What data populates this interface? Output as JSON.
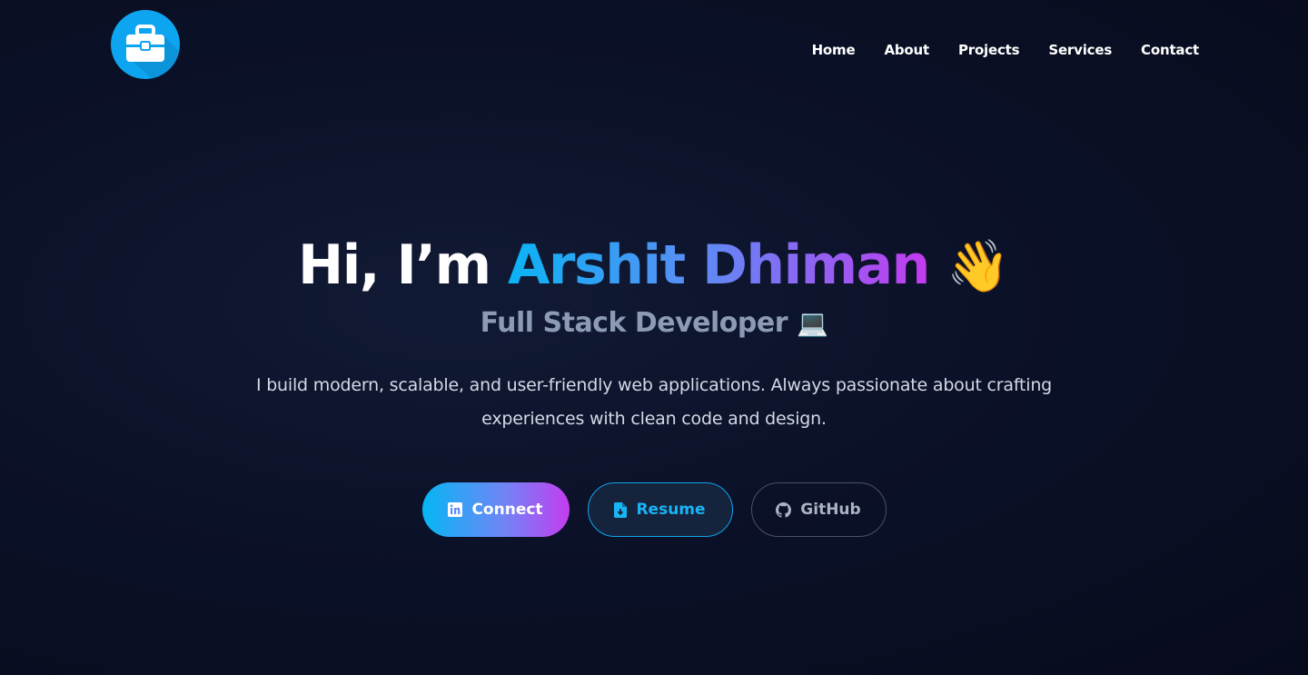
{
  "header": {
    "logo": {
      "icon": "briefcase-icon",
      "color": "#0ea5f0"
    },
    "nav": [
      "Home",
      "About",
      "Projects",
      "Services",
      "Contact"
    ]
  },
  "hero": {
    "greeting": "Hi, I’m",
    "name": "Arshit Dhiman",
    "wave_emoji": "👋",
    "subtitle": "Full Stack Developer",
    "laptop_emoji": "💻",
    "description": "I build modern, scalable, and user-friendly web applications. Always passionate about crafting experiences with clean code and design."
  },
  "buttons": {
    "connect": {
      "label": "Connect",
      "icon": "linkedin-icon"
    },
    "resume": {
      "label": "Resume",
      "icon": "file-download-icon"
    },
    "github": {
      "label": "GitHub",
      "icon": "github-icon"
    }
  },
  "colors": {
    "background": "#0b1128",
    "accent_blue": "#0ab4f5",
    "accent_purple": "#c43af0",
    "subtitle": "#8d9ab4"
  }
}
